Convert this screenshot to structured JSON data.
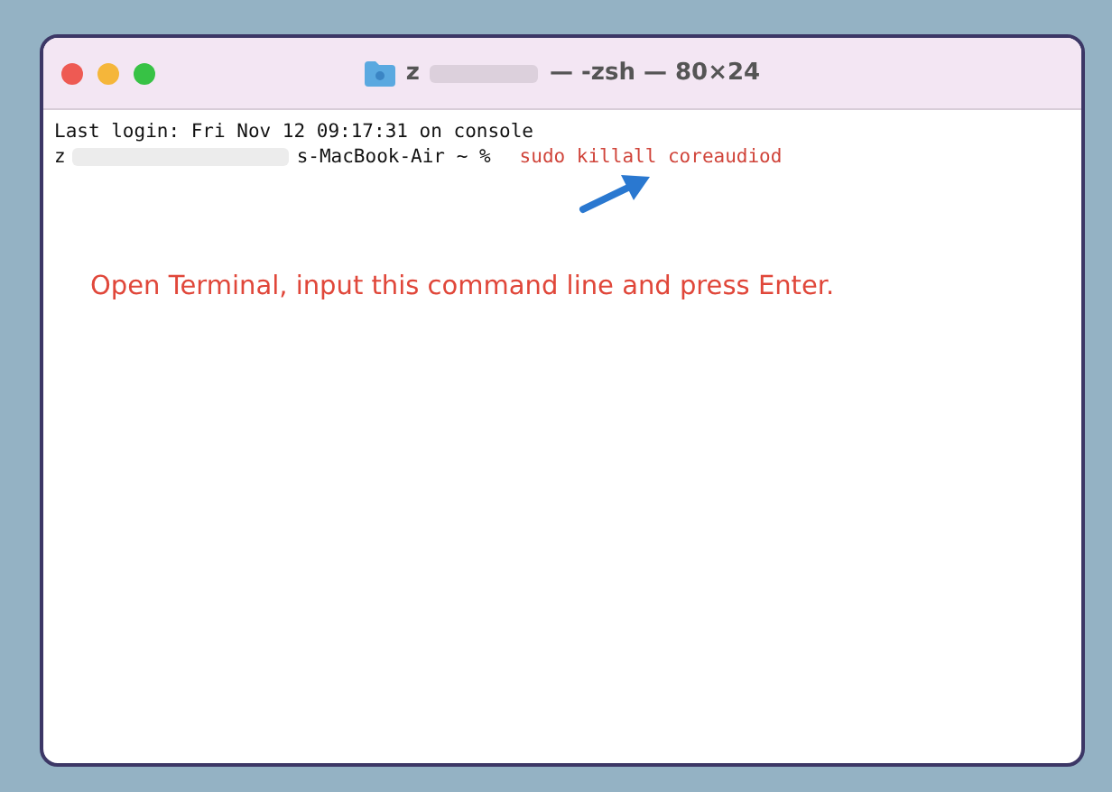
{
  "window": {
    "title_parts": [
      "z",
      "— -zsh — 80×24"
    ]
  },
  "terminal": {
    "lines": [
      {
        "kind": "plain",
        "text": "Last login: Fri Nov 12 09:17:31 on console"
      },
      {
        "kind": "prompt",
        "user": "z",
        "host": "s-MacBook-Air ~ %",
        "command": "sudo killall coreaudiod"
      }
    ]
  },
  "annotation": {
    "text": "Open Terminal, input this command line and press Enter."
  }
}
